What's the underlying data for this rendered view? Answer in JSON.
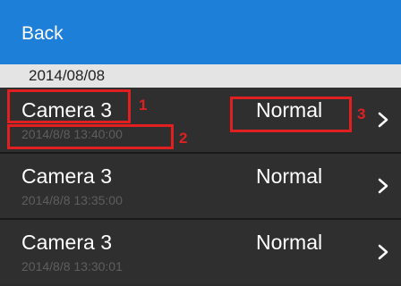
{
  "header": {
    "back_label": "Back",
    "background": "#1e7fd8"
  },
  "date_section": {
    "label": "2014/08/08"
  },
  "events": [
    {
      "camera": "Camera 3",
      "time": "2014/8/8 13:40:00",
      "status": "Normal"
    },
    {
      "camera": "Camera 3",
      "time": "2014/8/8 13:35:00",
      "status": "Normal"
    },
    {
      "camera": "Camera 3",
      "time": "2014/8/8 13:30:01",
      "status": "Normal"
    }
  ],
  "annotations": {
    "marker_1": "1",
    "marker_2": "2",
    "marker_3": "3",
    "color": "#e02020"
  },
  "icons": {
    "row_chevron": "chevron-right-icon"
  }
}
